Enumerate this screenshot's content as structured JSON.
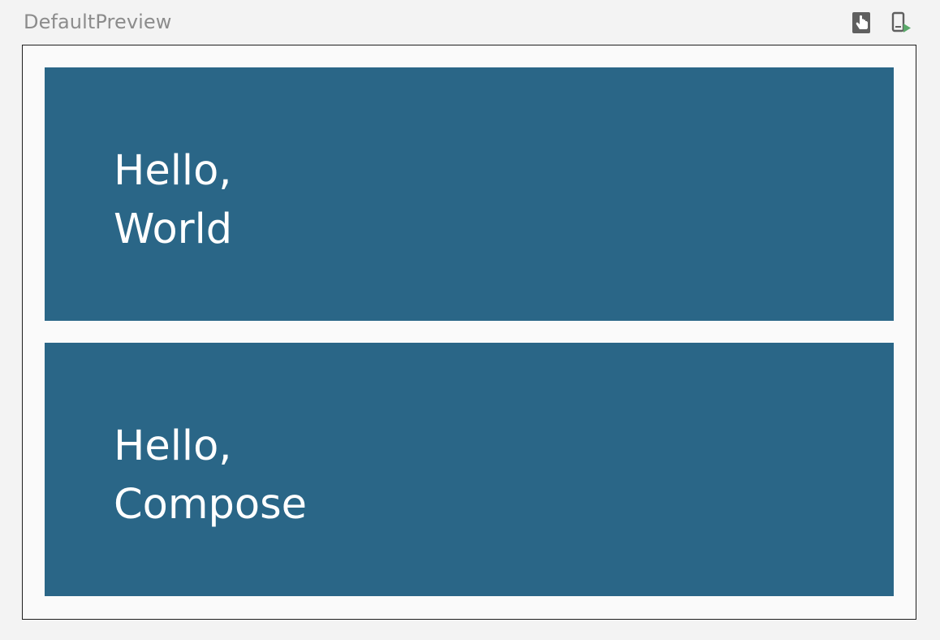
{
  "preview": {
    "title": "DefaultPreview"
  },
  "toolbar": {
    "interactive_icon": "touch-hand-icon",
    "deploy_icon": "device-run-icon",
    "colors": {
      "icon_gray": "#5f5f5f",
      "run_green": "#59a869"
    }
  },
  "colors": {
    "background": "#f3f3f3",
    "frame": "#fafafa",
    "card": "#2a6687",
    "card_text": "#ffffff"
  },
  "cards": [
    {
      "line1": "Hello,",
      "line2": "World"
    },
    {
      "line1": "Hello,",
      "line2": "Compose"
    }
  ]
}
